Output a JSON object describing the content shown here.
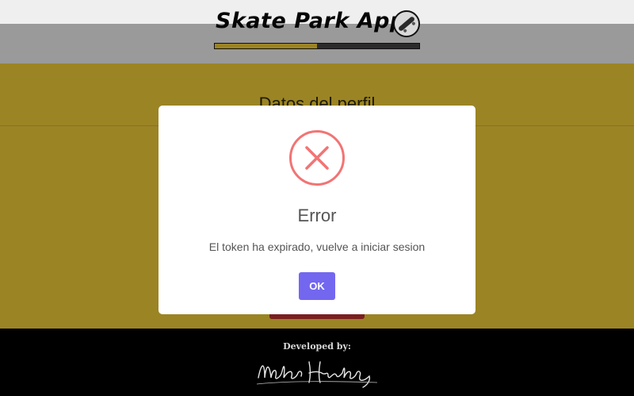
{
  "app": {
    "title": "Skate Park App",
    "logo_icon": "skateboard-icon",
    "progress_fraction": 0.5
  },
  "profile": {
    "heading": "Datos del perfil"
  },
  "footer": {
    "label": "Developed by:",
    "signature": "Waldo Hidalgo"
  },
  "dialog": {
    "icon": "error-x-icon",
    "title": "Error",
    "message": "El token ha expirado, vuelve a iniciar sesion",
    "ok_label": "OK"
  },
  "colors": {
    "accent_gold": "#9b8424",
    "header_gray": "#9a9a9a",
    "error_red": "#f27474",
    "confirm_purple": "#7367f0"
  }
}
